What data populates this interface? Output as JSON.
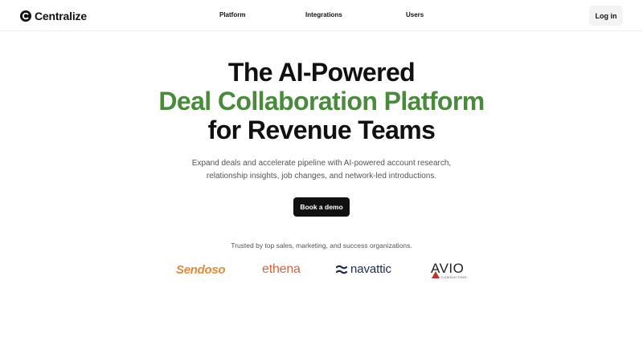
{
  "nav": {
    "brand": "Centralize",
    "links": [
      "Platform",
      "Integrations",
      "Users"
    ],
    "login": "Log in"
  },
  "hero": {
    "title_line1": "The AI-Powered",
    "title_line2": "Deal Collaboration Platform",
    "title_line3": "for Revenue Teams",
    "subtitle_line1": "Expand deals and accelerate pipeline with AI-powered account research,",
    "subtitle_line2": "relationship insights, job changes, and network-led introductions.",
    "cta": "Book a demo"
  },
  "trusted": {
    "text": "Trusted by top sales, marketing, and success organizations.",
    "logos": {
      "sendoso": "Sendoso",
      "ethena": "ethena",
      "navattic": "navattic",
      "avio": "AVIO",
      "avio_sub": "CONSULTING"
    }
  },
  "colors": {
    "accent": "#4a8a3c",
    "cta_bg": "#111111",
    "sendoso": "#e08a3c",
    "ethena": "#d9633d",
    "navattic": "#1d2a52",
    "avio_red": "#b8352b"
  }
}
